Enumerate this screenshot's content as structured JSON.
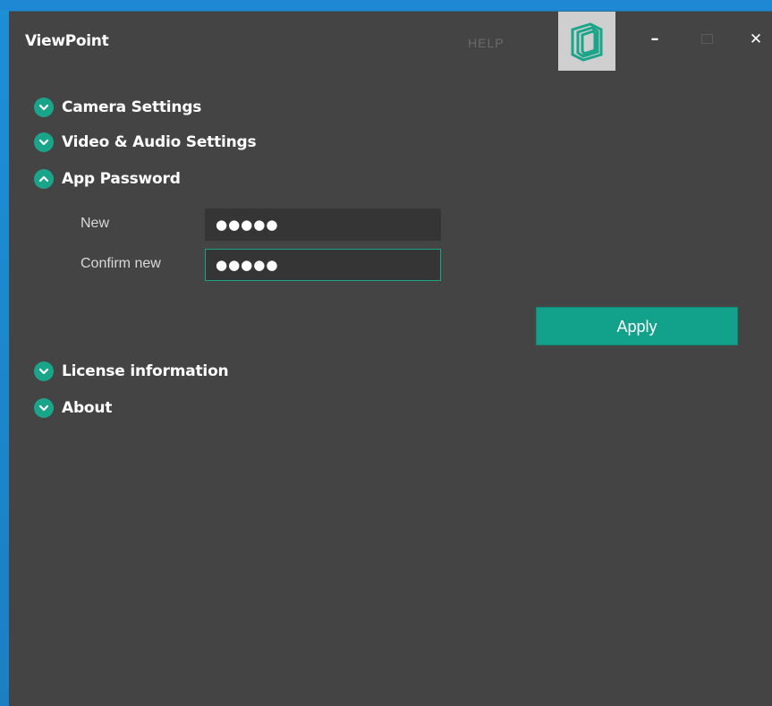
{
  "window": {
    "title": "ViewPoint",
    "help_label": "HELP",
    "logo_icon": "viewpoint-logo-icon",
    "minimize_glyph": "–",
    "close_glyph": "✕"
  },
  "colors": {
    "accent": "#1aa58a",
    "background": "#444444",
    "field_bg": "#353535"
  },
  "sections": [
    {
      "label": "Camera Settings",
      "expanded": false
    },
    {
      "label": "Video & Audio Settings",
      "expanded": false
    },
    {
      "label": "App Password",
      "expanded": true
    },
    {
      "label": "License information",
      "expanded": false
    },
    {
      "label": "About",
      "expanded": false
    }
  ],
  "password": {
    "new_label": "New",
    "new_value": "●●●●●",
    "confirm_label": "Confirm new",
    "confirm_value": "●●●●●",
    "apply_label": "Apply"
  }
}
